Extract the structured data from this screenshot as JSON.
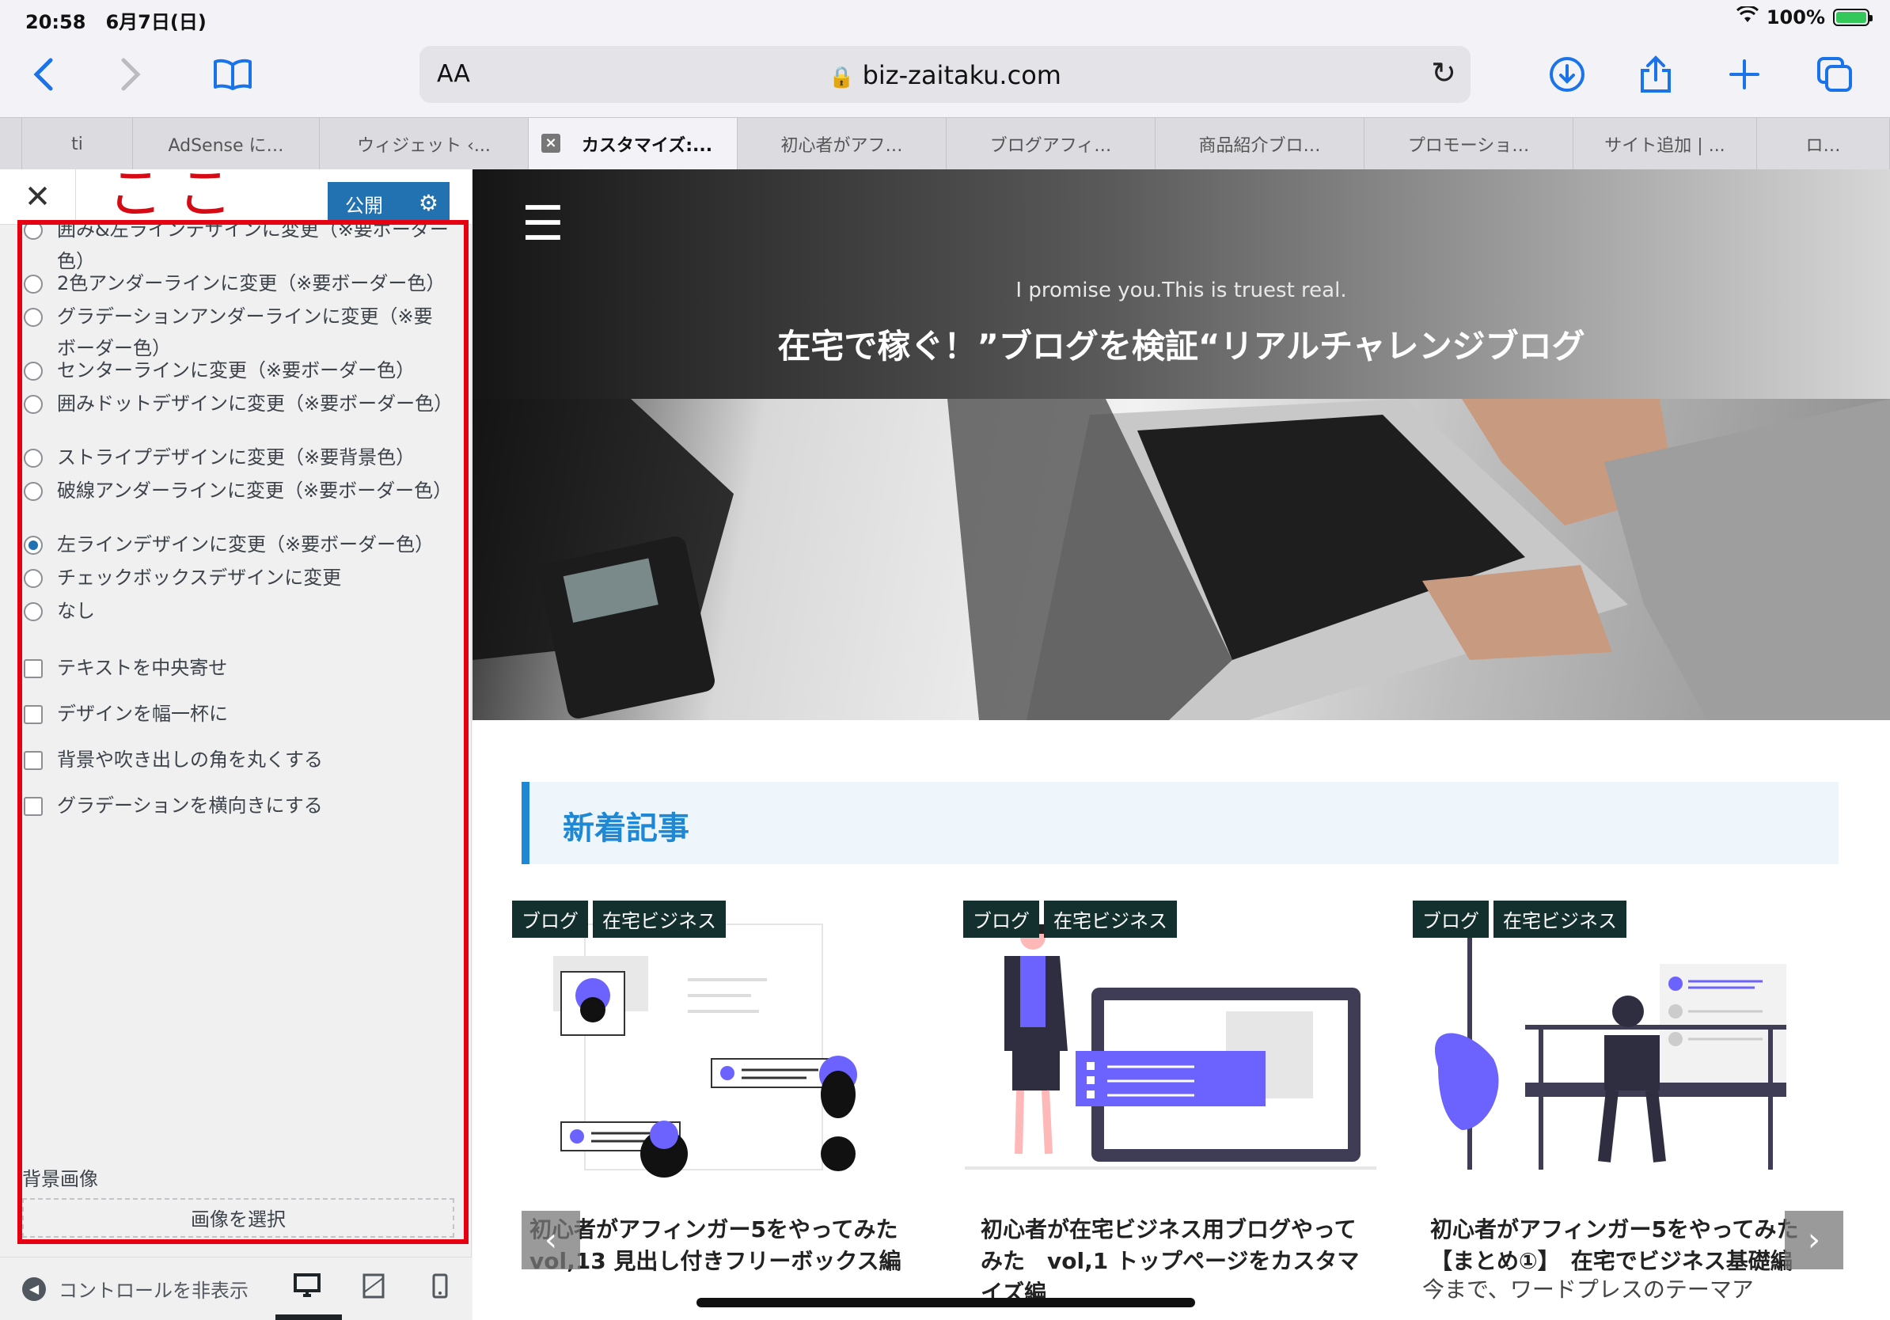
{
  "status": {
    "time": "20:58",
    "date": "6月7日(日)",
    "battery": "100%"
  },
  "toolbar": {
    "aa": "AA",
    "url": "biz-zaitaku.com"
  },
  "tabs": [
    {
      "label": "ti"
    },
    {
      "label": "AdSense に…"
    },
    {
      "label": "ウィジェット ‹..."
    },
    {
      "label": "カスタマイズ:..."
    },
    {
      "label": "初心者がアフ…"
    },
    {
      "label": "ブログアフィ…"
    },
    {
      "label": "商品紹介ブロ…"
    },
    {
      "label": "プロモーショ…"
    },
    {
      "label": "サイト追加 | ..."
    },
    {
      "label": "ロ…"
    }
  ],
  "annotation": {
    "koko": "ここ"
  },
  "customizer": {
    "publish": "公開",
    "options": [
      {
        "label": "囲み&左ラインデザインに変更（※要ボーダー色）",
        "type": "radio",
        "checked": false
      },
      {
        "label": "2色アンダーラインに変更（※要ボーダー色）",
        "type": "radio",
        "checked": false
      },
      {
        "label": "グラデーションアンダーラインに変更（※要ボーダー色）",
        "type": "radio",
        "checked": false
      },
      {
        "label": "センターラインに変更（※要ボーダー色）",
        "type": "radio",
        "checked": false
      },
      {
        "label": "囲みドットデザインに変更（※要ボーダー色）",
        "type": "radio",
        "checked": false
      },
      {
        "label": "ストライプデザインに変更（※要背景色）",
        "type": "radio",
        "checked": false
      },
      {
        "label": "破線アンダーラインに変更（※要ボーダー色）",
        "type": "radio",
        "checked": false
      },
      {
        "label": "左ラインデザインに変更（※要ボーダー色）",
        "type": "radio",
        "checked": true
      },
      {
        "label": "チェックボックスデザインに変更",
        "type": "radio",
        "checked": false
      },
      {
        "label": "なし",
        "type": "radio",
        "checked": false
      },
      {
        "label": "テキストを中央寄せ",
        "type": "checkbox",
        "checked": false
      },
      {
        "label": "デザインを幅一杯に",
        "type": "checkbox",
        "checked": false
      },
      {
        "label": "背景や吹き出しの角を丸くする",
        "type": "checkbox",
        "checked": false
      },
      {
        "label": "グラデーションを横向きにする",
        "type": "checkbox",
        "checked": false
      }
    ],
    "bg_image_label": "背景画像",
    "select_image": "画像を選択",
    "hide_controls": "コントロールを非表示"
  },
  "preview": {
    "tagline": "I promise you.This is truest real.",
    "site_title": "在宅で稼ぐ！”ブログを検証“リアルチャレンジブログ",
    "section_title": "新着記事",
    "cards": [
      {
        "tag1": "ブログ",
        "tag2": "在宅ビジネス",
        "title": "初心者がアフィンガー5をやってみた　vol,13 見出し付きフリーボックス編",
        "excerpt": ""
      },
      {
        "tag1": "ブログ",
        "tag2": "在宅ビジネス",
        "title": "初心者が在宅ビジネス用ブログやってみた　vol,1 トップページをカスタマイズ編",
        "excerpt": ""
      },
      {
        "tag1": "ブログ",
        "tag2": "在宅ビジネス",
        "title": "初心者がアフィンガー5をやってみた【まとめ①】　在宅でビジネス基礎編",
        "excerpt": "今まで、ワードプレスのテーマア"
      }
    ]
  },
  "colors": {
    "accent": "#1e88d5",
    "publish": "#2271b1",
    "annotation": "#e60012",
    "tag_bg": "#13302e",
    "ios_blue": "#1a73e8"
  }
}
